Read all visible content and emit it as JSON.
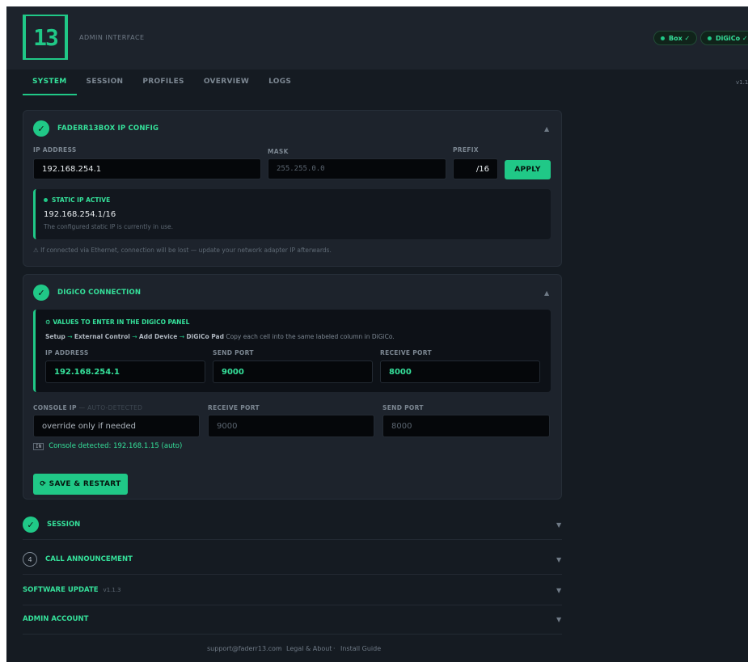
{
  "header": {
    "logo_text": "13",
    "admin_label": "ADMIN INTERFACE",
    "badges": [
      "Box ✓",
      "DiGiCo ✓"
    ]
  },
  "tabs": [
    "SYSTEM",
    "SESSION",
    "PROFILES",
    "OVERVIEW",
    "LOGS"
  ],
  "version": "v1.1.",
  "ip_config": {
    "title": "FADERR13BOX IP CONFIG",
    "ip_label": "IP ADDRESS",
    "ip_value": "192.168.254.1",
    "mask_label": "MASK",
    "mask_placeholder": "255.255.0.0",
    "prefix_label": "PREFIX",
    "prefix_value": "/16",
    "apply_label": "APPLY",
    "status_title": "STATIC IP ACTIVE",
    "status_value": "192.168.254.1/16",
    "status_note": "The configured static IP is currently in use.",
    "warning": "⚠ If connected via Ethernet, connection will be lost — update your network adapter IP afterwards."
  },
  "digico": {
    "title": "DIGICO CONNECTION",
    "values_title": "⚙ VALUES TO ENTER IN THE DIGICO PANEL",
    "path": [
      "Setup",
      "External Control",
      "Add Device",
      "DiGiCo Pad"
    ],
    "path_note": "Copy each cell into the same labeled column in DiGiCo.",
    "cols": [
      "IP ADDRESS",
      "SEND PORT",
      "RECEIVE PORT"
    ],
    "vals": [
      "192.168.254.1",
      "9000",
      "8000"
    ],
    "console_ip_label": "CONSOLE IP",
    "console_ip_sub": "— AUTO-DETECTED",
    "console_ip_placeholder": "override only if needed",
    "receive_port_label": "RECEIVE PORT",
    "receive_port_placeholder": "9000",
    "send_port_label": "SEND PORT",
    "send_port_placeholder": "8000",
    "detected": "Console detected: 192.168.1.15 (auto)",
    "save_label": "⟳ SAVE & RESTART"
  },
  "sections": {
    "session": "SESSION",
    "call_num": "4",
    "call": "CALL ANNOUNCEMENT",
    "software": "SOFTWARE UPDATE",
    "software_version": "v1.1.3",
    "admin": "ADMIN ACCOUNT"
  },
  "footer": [
    "support@faderr13.com",
    "Legal & About",
    "Install Guide"
  ]
}
